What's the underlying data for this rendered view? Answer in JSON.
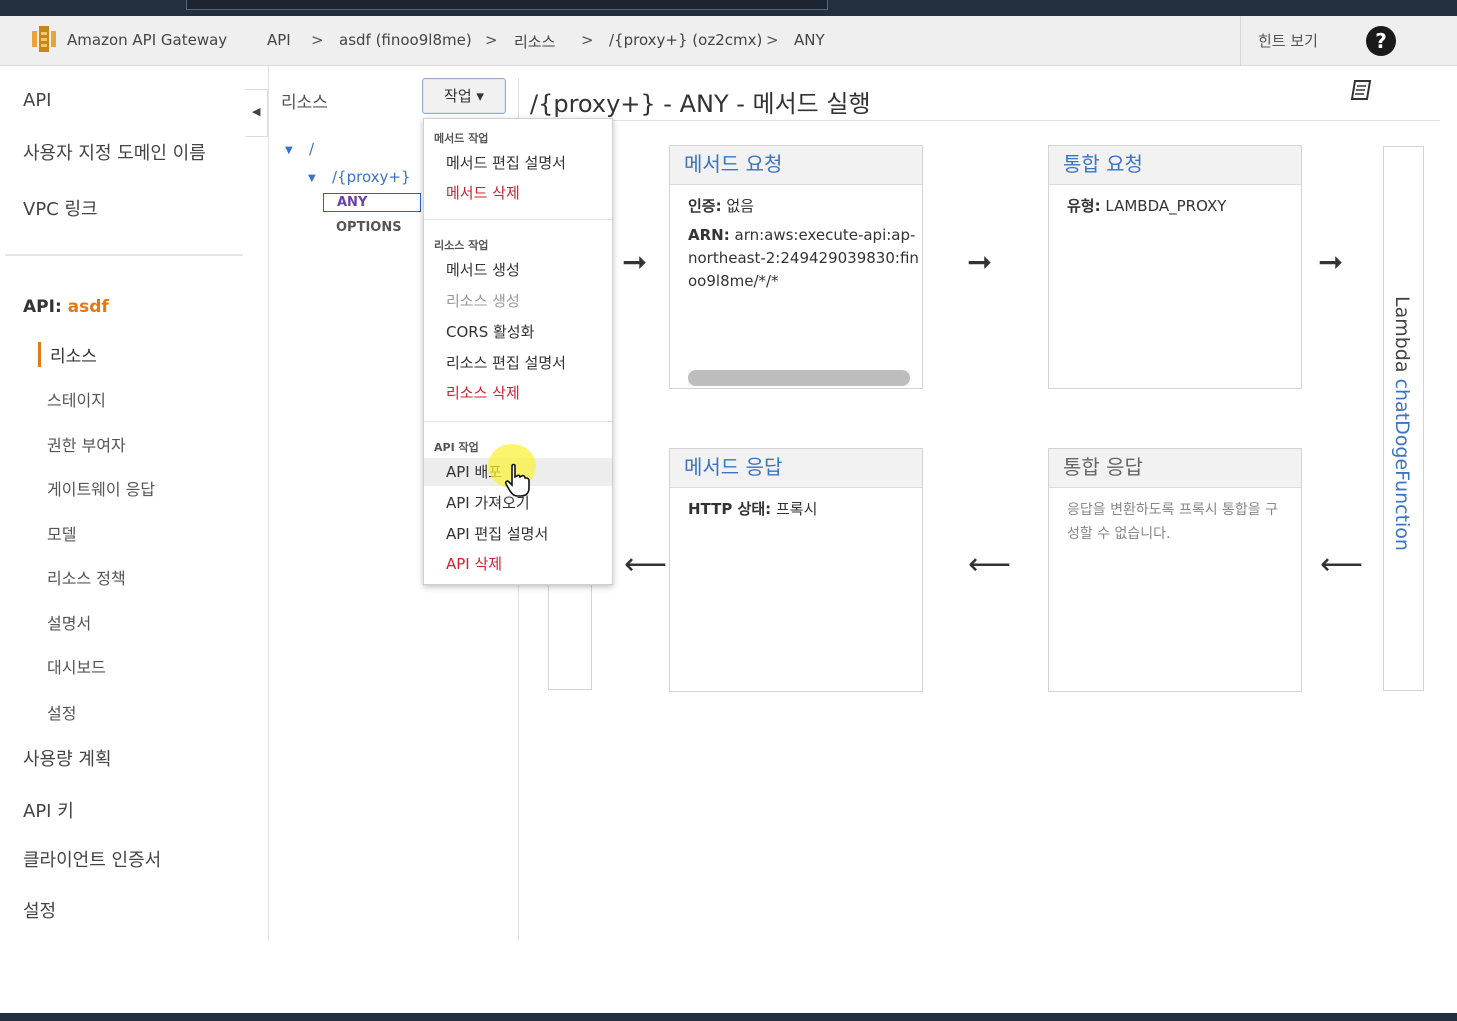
{
  "header": {
    "brand": "Amazon API Gateway",
    "breadcrumbs": [
      "API",
      "asdf (finoo9l8me)",
      "리소스",
      "/{proxy+} (oz2cmx)",
      "ANY"
    ],
    "separator": ">",
    "hint_label": "힌트 보기",
    "help_label": "?"
  },
  "sidebar": {
    "top_items": [
      "API",
      "사용자 지정 도메인 이름",
      "VPC 링크"
    ],
    "api_prefix": "API:",
    "api_name": "asdf",
    "sub_items": [
      "리소스",
      "스테이지",
      "권한 부여자",
      "게이트웨이 응답",
      "모델",
      "리소스 정책",
      "설명서",
      "대시보드",
      "설정"
    ],
    "bottom_items": [
      "사용량 계획",
      "API 키",
      "클라이언트 인증서",
      "설정"
    ]
  },
  "resources": {
    "title": "리소스",
    "actions_label": "작업 ▾",
    "tree": [
      "/",
      "/{proxy+}",
      "ANY",
      "OPTIONS"
    ]
  },
  "actions_menu": {
    "method_header": "메서드 작업",
    "method_items": [
      "메서드 편집 설명서",
      "메서드 삭제"
    ],
    "resource_header": "리소스 작업",
    "resource_items": [
      "메서드 생성",
      "리소스 생성",
      "CORS 활성화",
      "리소스 편집 설명서",
      "리소스 삭제"
    ],
    "api_header": "API 작업",
    "api_items": [
      "API 배포",
      "API 가져오기",
      "API 편집 설명서",
      "API 삭제"
    ]
  },
  "main": {
    "title": "/{proxy+} - ANY - 메서드 실행",
    "method_request": {
      "header": "메서드 요청",
      "auth_label": "인증:",
      "auth_value": "없음",
      "arn_label": "ARN:",
      "arn_value": "arn:aws:execute-api:ap-northeast-2:249429039830:finoo9l8me/*/*"
    },
    "integration_request": {
      "header": "통합 요청",
      "type_label": "유형:",
      "type_value": "LAMBDA_PROXY"
    },
    "method_response": {
      "header": "메서드 응답",
      "status_label": "HTTP 상태:",
      "status_value": "프록시"
    },
    "integration_response": {
      "header": "통합 응답",
      "note": "응답을 변환하도록 프록시 통합을 구성할 수 없습니다."
    },
    "lambda_prefix": "Lambda",
    "lambda_function": "chatDogeFunction",
    "arrow_right": "➞",
    "arrow_left": "⟵"
  },
  "colors": {
    "accent": "#e47911",
    "link": "#3b73c7",
    "danger": "#d0222e",
    "navbar": "#232f3e"
  }
}
